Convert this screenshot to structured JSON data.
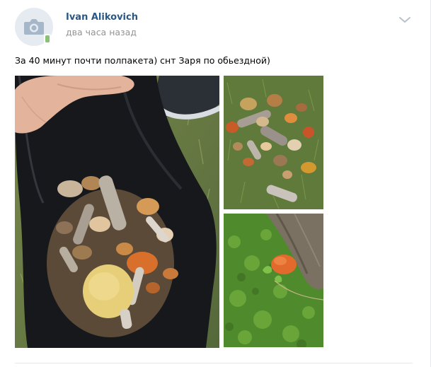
{
  "post": {
    "author": "Ivan Alikovich",
    "time": "два часа назад",
    "text": "За 40 минут почти полпакета) снт Заря по обьездной)"
  },
  "icons": {
    "avatar": "camera-icon",
    "online": "mobile-online-icon",
    "menu": "chevron-down-icon"
  },
  "colors": {
    "author_link": "#2a5885",
    "time": "#939393",
    "avatar_bg": "#e5ebf1",
    "online_badge": "#8ac176"
  }
}
